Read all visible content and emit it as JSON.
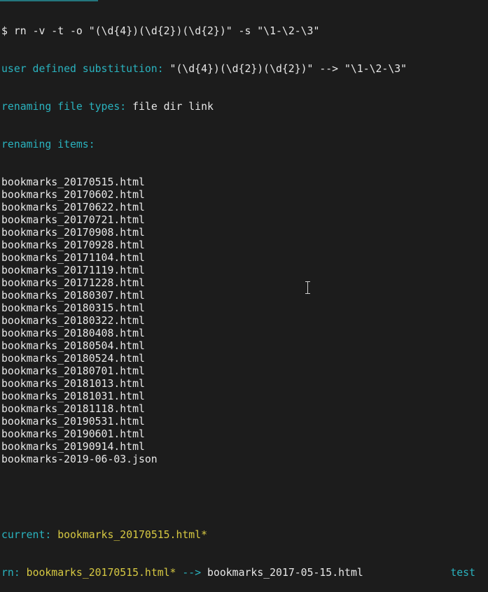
{
  "terminal": {
    "prompt_symbol": "$",
    "command": "rn -v -t -o \"(\\d{4})(\\d{2})(\\d{2})\" -s \"\\1-\\2-\\3\"",
    "substitution_label": "user defined substitution:",
    "substitution_value": "\"(\\d{4})(\\d{2})(\\d{2})\" --> \"\\1-\\2-\\3\"",
    "filetypes_label": "renaming file types:",
    "filetypes_value": "file dir link",
    "items_label": "renaming items:",
    "items": [
      "bookmarks_20170515.html",
      "bookmarks_20170602.html",
      "bookmarks_20170622.html",
      "bookmarks_20170721.html",
      "bookmarks_20170908.html",
      "bookmarks_20170928.html",
      "bookmarks_20171104.html",
      "bookmarks_20171119.html",
      "bookmarks_20171228.html",
      "bookmarks_20180307.html",
      "bookmarks_20180315.html",
      "bookmarks_20180322.html",
      "bookmarks_20180408.html",
      "bookmarks_20180504.html",
      "bookmarks_20180524.html",
      "bookmarks_20180701.html",
      "bookmarks_20181013.html",
      "bookmarks_20181031.html",
      "bookmarks_20181118.html",
      "bookmarks_20190531.html",
      "bookmarks_20190601.html",
      "bookmarks_20190914.html",
      "bookmarks-2019-06-03.json"
    ],
    "current_label": "current:",
    "current_value": "bookmarks_20170515.html*",
    "rn_label": "rn:",
    "rn_source": "bookmarks_20170515.html*",
    "rn_arrow": "-->",
    "rn_target": "bookmarks_2017-05-15.html",
    "mode_tag": "test"
  },
  "colors": {
    "background": "#1c1c1c",
    "text": "#e6e6e6",
    "label_cyan": "#2ab3bf",
    "highlight_yellow": "#d7c942"
  },
  "icons": {
    "mouse_cursor": "ibeam-cursor-icon"
  }
}
